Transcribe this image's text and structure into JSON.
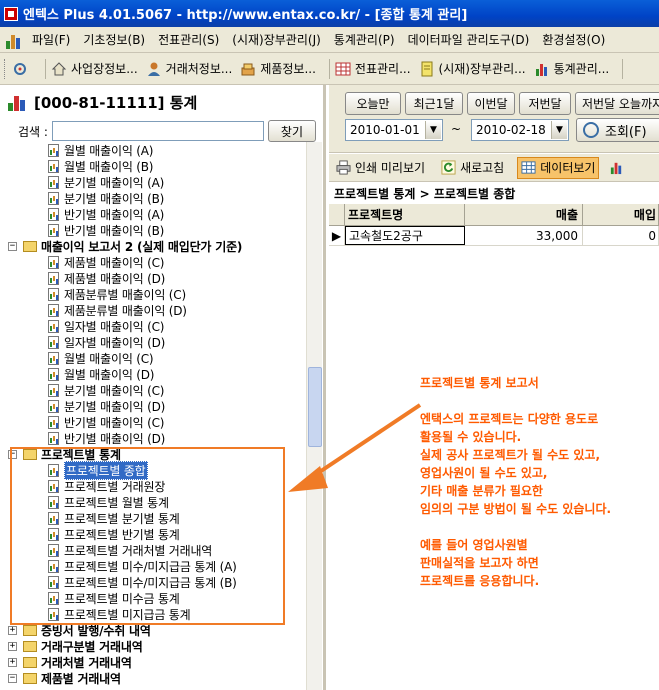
{
  "window": {
    "title": "엔텍스 Plus 4.01.5067 - http://www.entax.co.kr/ - [종합 통계 관리]"
  },
  "menu": [
    {
      "label": "파일(F)"
    },
    {
      "label": "기초정보(B)"
    },
    {
      "label": "전표관리(S)"
    },
    {
      "label": "(시재)장부관리(J)"
    },
    {
      "label": "통계관리(P)"
    },
    {
      "label": "데이터파일 관리도구(D)"
    },
    {
      "label": "환경설정(O)"
    }
  ],
  "toolbar": [
    {
      "label": "사업장정보...",
      "icon": "home-icon"
    },
    {
      "label": "거래처정보...",
      "icon": "person-icon"
    },
    {
      "label": "제품정보...",
      "icon": "product-icon"
    },
    {
      "label": "전표관리...",
      "icon": "grid-icon"
    },
    {
      "label": "(시재)장부관리...",
      "icon": "notebook-icon"
    },
    {
      "label": "통계관리...",
      "icon": "bar-chart-icon"
    }
  ],
  "left": {
    "header": "[000-81-11111] 통계",
    "search_label": "검색 :",
    "search_value": "",
    "find_button": "찾기",
    "tree": [
      {
        "type": "child",
        "label": "월별 매출이익 (A)"
      },
      {
        "type": "child",
        "label": "월별 매출이익 (B)"
      },
      {
        "type": "child",
        "label": "분기별 매출이익 (A)"
      },
      {
        "type": "child",
        "label": "분기별 매출이익 (B)"
      },
      {
        "type": "child",
        "label": "반기별 매출이익 (A)"
      },
      {
        "type": "child",
        "label": "반기별 매출이익 (B)"
      },
      {
        "type": "group",
        "label": "매출이익 보고서 2 (실제 매입단가 기준)",
        "expander": "−"
      },
      {
        "type": "child",
        "label": "제품별 매출이익 (C)"
      },
      {
        "type": "child",
        "label": "제품별 매출이익 (D)"
      },
      {
        "type": "child",
        "label": "제품분류별 매출이익 (C)"
      },
      {
        "type": "child",
        "label": "제품분류별 매출이익 (D)"
      },
      {
        "type": "child",
        "label": "일자별 매출이익 (C)"
      },
      {
        "type": "child",
        "label": "일자별 매출이익 (D)"
      },
      {
        "type": "child",
        "label": "월별 매출이익 (C)"
      },
      {
        "type": "child",
        "label": "월별 매출이익 (D)"
      },
      {
        "type": "child",
        "label": "분기별 매출이익 (C)"
      },
      {
        "type": "child",
        "label": "분기별 매출이익 (D)"
      },
      {
        "type": "child",
        "label": "반기별 매출이익 (C)"
      },
      {
        "type": "child",
        "label": "반기별 매출이익 (D)"
      },
      {
        "type": "group",
        "label": "프로젝트별 통계",
        "expander": "−"
      },
      {
        "type": "child",
        "label": "프로젝트별 종합",
        "selected": true
      },
      {
        "type": "child",
        "label": "프로젝트별 거래원장"
      },
      {
        "type": "child",
        "label": "프로젝트별 월별 통계"
      },
      {
        "type": "child",
        "label": "프로젝트별 분기별 통계"
      },
      {
        "type": "child",
        "label": "프로젝트별 반기별 통계"
      },
      {
        "type": "child",
        "label": "프로젝트별 거래처별 거래내역"
      },
      {
        "type": "child",
        "label": "프로젝트별 미수/미지급금 통계 (A)"
      },
      {
        "type": "child",
        "label": "프로젝트별 미수/미지급금 통계 (B)"
      },
      {
        "type": "child",
        "label": "프로젝트별 미수금 통계"
      },
      {
        "type": "child",
        "label": "프로젝트별 미지급금 통계"
      },
      {
        "type": "group",
        "label": "증빙서 발행/수취 내역",
        "expander": "+"
      },
      {
        "type": "group",
        "label": "거래구분별 거래내역",
        "expander": "+"
      },
      {
        "type": "group",
        "label": "거래처별 거래내역",
        "expander": "+"
      },
      {
        "type": "group",
        "label": "제품별 거래내역",
        "expander": "−"
      }
    ]
  },
  "right": {
    "quick_buttons": [
      "오늘만",
      "최근1달",
      "이번달",
      "저번달",
      "저번달 오늘까지"
    ],
    "date_from": "2010-01-01",
    "date_tilde": "~",
    "date_to": "2010-02-18",
    "query_button": "조회(F)",
    "actions": [
      {
        "label": "인쇄 미리보기",
        "icon": "printer-icon"
      },
      {
        "label": "새로고침",
        "icon": "refresh-icon"
      },
      {
        "label": "데이터보기",
        "icon": "data-view-icon",
        "active": true
      }
    ],
    "breadcrumb": "프로젝트별 통계 > 프로젝트별 종합",
    "columns": [
      "프로젝트명",
      "매출",
      "매입"
    ],
    "rows": [
      {
        "name": "고속철도2공구",
        "sales": "33,000",
        "purchase": "0"
      }
    ]
  },
  "annotation": {
    "title": "프로젝트별 통계 보고서",
    "paragraph1": [
      "엔택스의 프로젝트는 다양한 용도로",
      "활용될 수 있습니다.",
      "실제 공사 프로젝트가 될 수도 있고,",
      "영업사원이 될 수도 있고,",
      "기타 매출 분류가 필요한",
      "임의의 구분 방법이 될 수도 있습니다."
    ],
    "paragraph2": [
      "예를 들어 영업사원별",
      "판매실적을 보고자 하면",
      "프로젝트를 응용합니다."
    ]
  },
  "colors": {
    "accent_orange": "#f07b26",
    "annotation_text": "#ff5a00",
    "titlebar_blue": "#0043c6",
    "selection_blue": "#316ac5"
  }
}
